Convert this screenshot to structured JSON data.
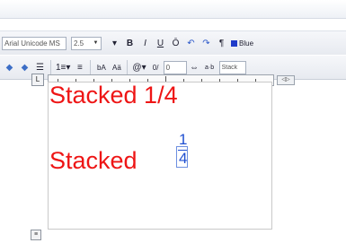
{
  "toolbar1": {
    "font_name": "Arial Unicode MS",
    "font_size": "2.5",
    "bold_icon": "B",
    "italic_icon": "I",
    "underline_icon": "U",
    "overline_icon": "Ō",
    "undo_icon": "↶",
    "redo_icon": "↷",
    "color_label": "Blue"
  },
  "toolbar2": {
    "indent_value": "0",
    "stack_label": "Stack"
  },
  "ruler": {
    "corner_label": "L"
  },
  "editor": {
    "line1_text": "Stacked 1/4",
    "line2_text": "Stacked ",
    "fraction_numerator": "1",
    "fraction_denominator": "4"
  },
  "colors": {
    "text_red": "#ee1515",
    "stack_blue": "#1f4fd1"
  }
}
